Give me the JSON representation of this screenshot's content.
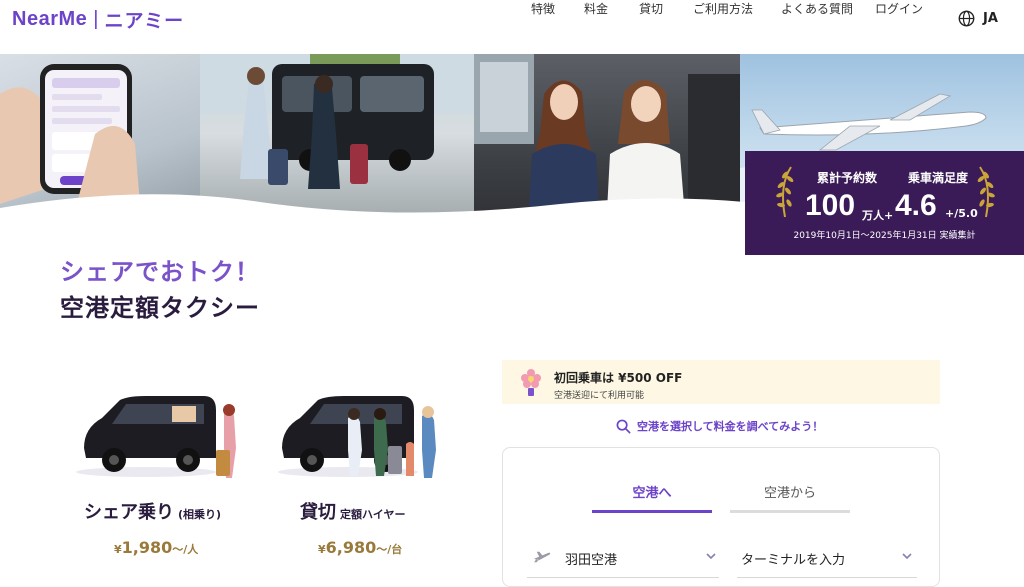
{
  "header": {
    "logo_en": "NearMe",
    "logo_sep": "|",
    "logo_ja": "ニアミー",
    "nav": [
      {
        "label": "特徴"
      },
      {
        "label": "料金"
      },
      {
        "label": "貸切"
      },
      {
        "label": "ご利用方法"
      },
      {
        "label": "よくある質問"
      },
      {
        "label": "ログイン"
      }
    ],
    "language": "JA",
    "language_icon": "globe-icon"
  },
  "stats": {
    "reservations_label": "累計予約数",
    "reservations_value": "100",
    "reservations_unit": "万人+",
    "satisfaction_label": "乗車満足度",
    "satisfaction_value": "4.6",
    "satisfaction_unit": "+/5.0",
    "period": "2019年10月1日～2025年1月31日 実績集計"
  },
  "hero": {
    "tagline": "シェアでおトク！",
    "headline": "空港定額タクシー"
  },
  "services": [
    {
      "title": "シェア乗り",
      "subtitle": "(相乗り)",
      "currency": "¥",
      "price": "1,980",
      "unit": "〜/人"
    },
    {
      "title": "貸切",
      "subtitle": "定額ハイヤー",
      "currency": "¥",
      "price": "6,980",
      "unit": "〜/台"
    }
  ],
  "promo": {
    "title": "初回乗車は ¥500 OFF",
    "note": "空港送迎にて利用可能"
  },
  "search_link": "空港を選択して料金を調べてみよう！",
  "booking": {
    "tabs": [
      {
        "label": "空港へ",
        "active": true
      },
      {
        "label": "空港から",
        "active": false
      }
    ],
    "airport": "羽田空港",
    "terminal_placeholder": "ターミナルを入力"
  },
  "colors": {
    "brand": "#6c43c9",
    "stats_bg": "#3a1a57",
    "promo_bg": "#fdf7e3",
    "price": "#9a7a3a"
  }
}
